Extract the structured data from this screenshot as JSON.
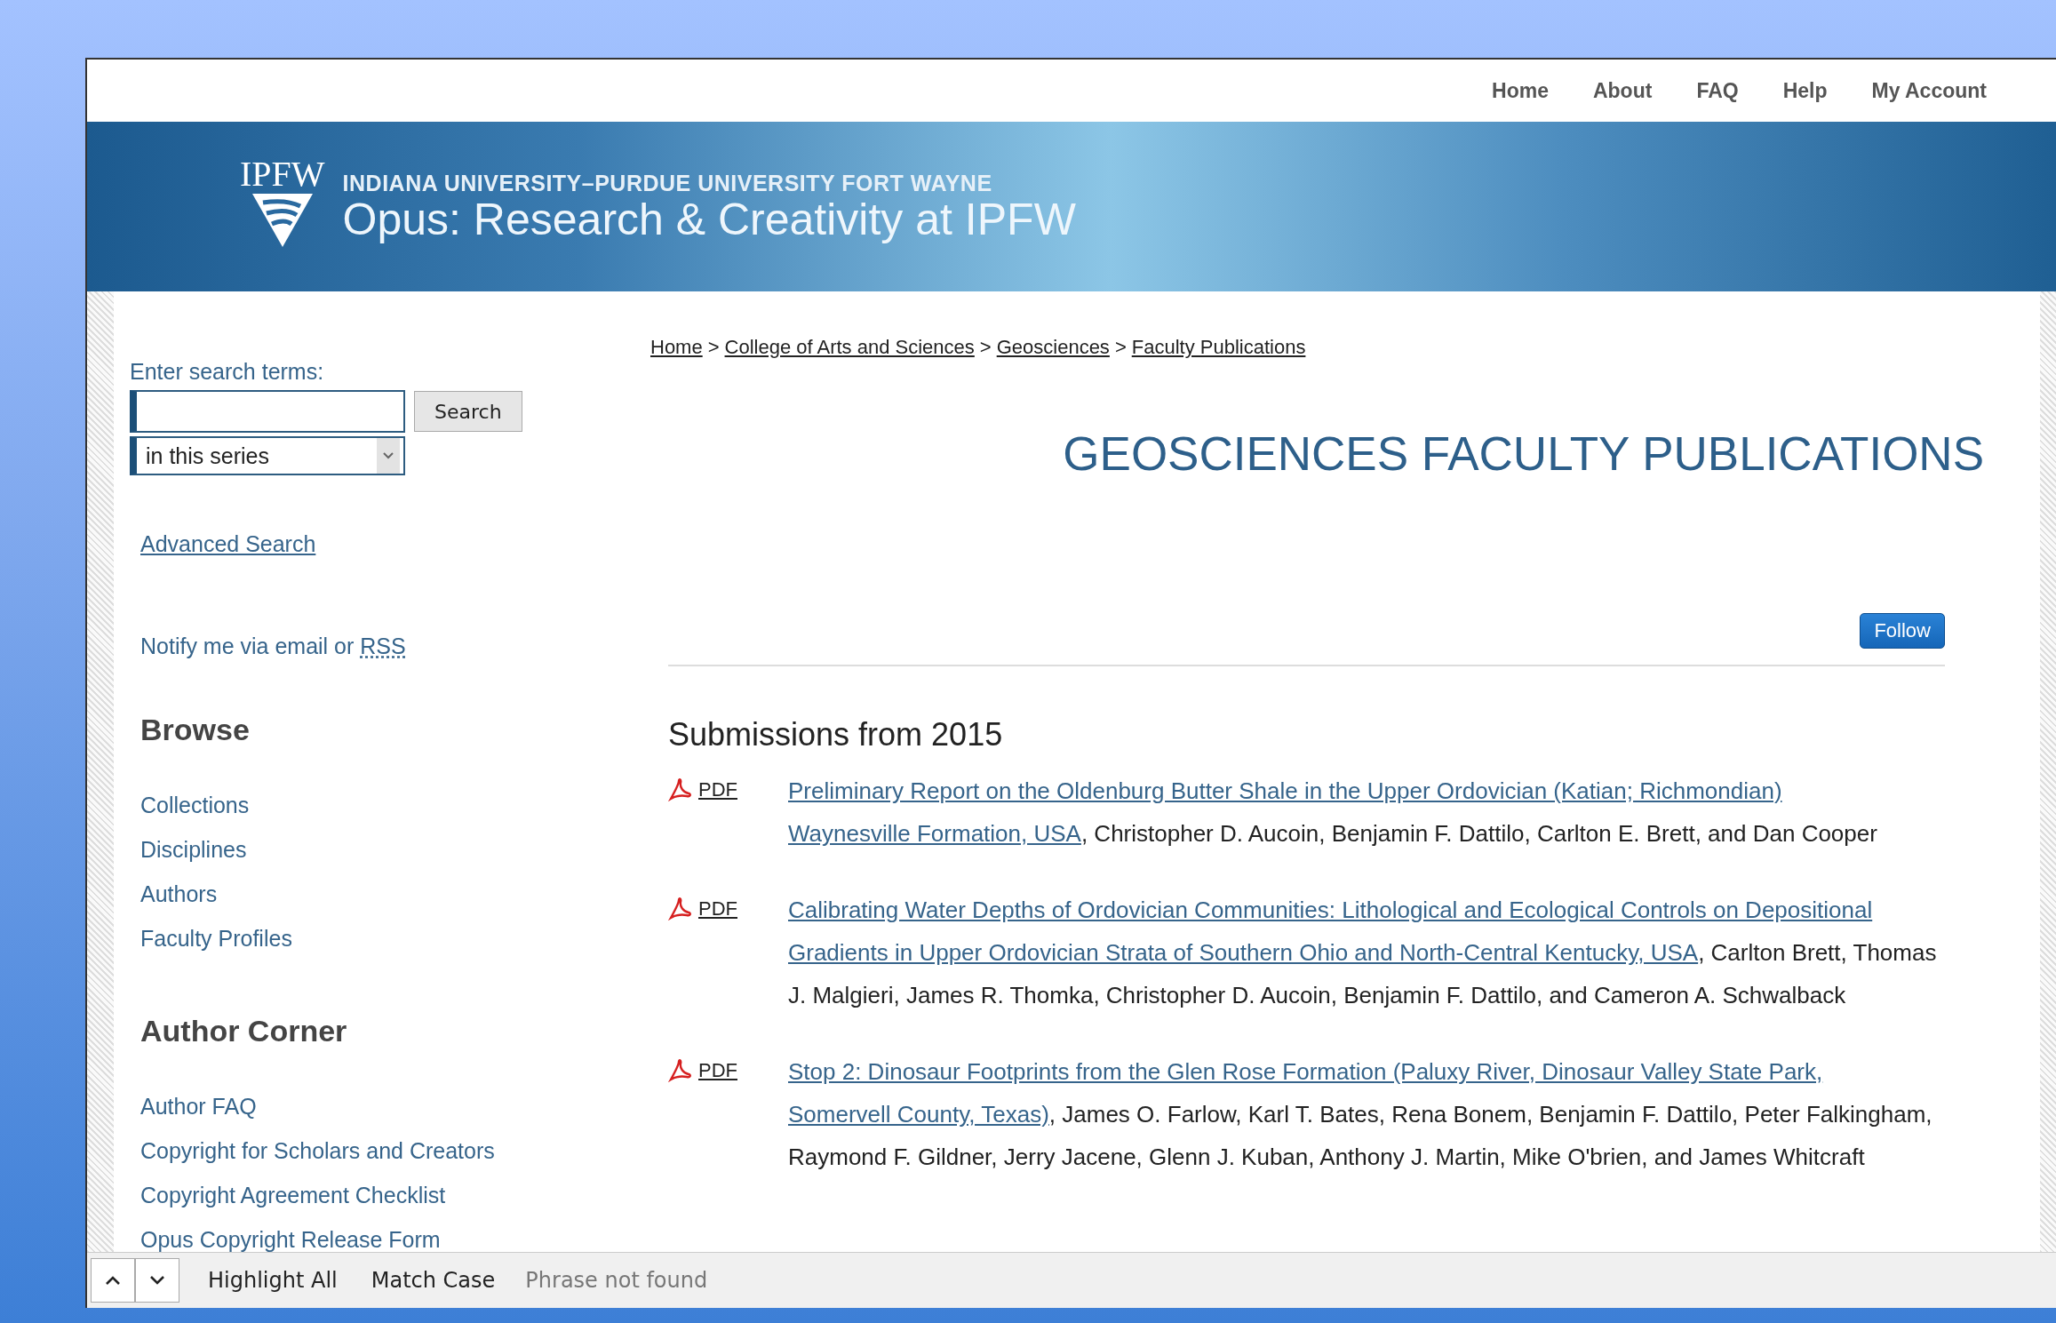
{
  "top_nav": [
    "Home",
    "About",
    "FAQ",
    "Help",
    "My Account"
  ],
  "banner": {
    "logo_text": "IPFW",
    "subtitle": "INDIANA UNIVERSITY–PURDUE UNIVERSITY FORT WAYNE",
    "title": "Opus: Research & Creativity at IPFW"
  },
  "sidebar": {
    "search_label": "Enter search terms:",
    "search_button": "Search",
    "scope": "in this series",
    "advanced_search": "Advanced Search",
    "notify_text": "Notify me via email or",
    "notify_link": "RSS",
    "sections": [
      {
        "heading": "Browse",
        "items": [
          "Collections",
          "Disciplines",
          "Authors",
          "Faculty Profiles"
        ]
      },
      {
        "heading": "Author Corner",
        "items": [
          "Author FAQ",
          "Copyright for Scholars and Creators",
          "Copyright Agreement Checklist",
          "Opus Copyright Release Form"
        ]
      }
    ]
  },
  "breadcrumb": {
    "separator": ">",
    "items": [
      "Home",
      "College of Arts and Sciences",
      "Geosciences",
      "Faculty Publications"
    ]
  },
  "page_title": "GEOSCIENCES FACULTY PUBLICATIONS",
  "follow_button": "Follow",
  "section_heading": "Submissions from 2015",
  "publications": [
    {
      "format": "PDF",
      "title_lines": [
        "Preliminary Report on the Oldenburg Butter Shale in the Upper Ordovician (Katian; Richmondian)",
        "Waynesville Formation, USA"
      ],
      "authors": ", Christopher D. Aucoin, Benjamin F. Dattilo, Carlton E. Brett, and Dan Cooper"
    },
    {
      "format": "PDF",
      "title_lines": [
        "Calibrating Water Depths of Ordovician Communities: Lithological and Ecological Controls on Depositional",
        "Gradients in Upper Ordovician Strata of Southern Ohio and North-Central Kentucky, USA"
      ],
      "authors": ", Carlton Brett, Thomas J. Malgieri, James R. Thomka, Christopher D. Aucoin, Benjamin F. Dattilo, and Cameron A. Schwalback"
    },
    {
      "format": "PDF",
      "title_lines": [
        "Stop 2: Dinosaur Footprints from the Glen Rose Formation (Paluxy River, Dinosaur Valley State Park,",
        "Somervell County, Texas)"
      ],
      "authors": ", James O. Farlow, Karl T. Bates, Rena Bonem, Benjamin F. Dattilo, Peter Falkingham, Raymond F. Gildner, Jerry Jacene, Glenn J. Kuban, Anthony J. Martin, Mike O'brien, and James Whitcraft"
    }
  ],
  "find_bar": {
    "highlight_all": "Highlight All",
    "match_case": "Match Case",
    "status": "Phrase not found"
  }
}
